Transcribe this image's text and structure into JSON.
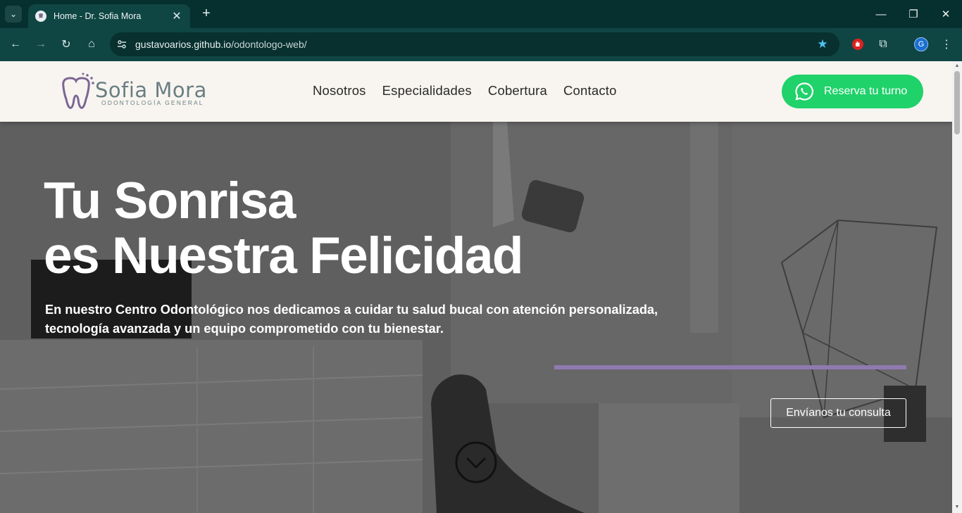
{
  "browser": {
    "tab_title": "Home - Dr. Sofia Mora",
    "new_tab": "+",
    "url_host": "gustavoarios.github.io",
    "url_path": "/odontologo-web/",
    "profile_initial": "G",
    "icons": [
      "tab-search-icon",
      "favicon-icon",
      "close-icon",
      "minimize-icon",
      "maximize-icon",
      "window-close-icon",
      "back-icon",
      "forward-icon",
      "reload-icon",
      "home-icon",
      "site-info-icon",
      "bookmark-star-icon",
      "extension-icon",
      "puzzle-icon",
      "more-icon"
    ]
  },
  "header": {
    "logo_name": "Sofia Mora",
    "logo_sub": "ODONTOLOGÍA GENERAL",
    "nav": [
      "Nosotros",
      "Especialidades",
      "Cobertura",
      "Contacto"
    ],
    "cta_label": "Reserva tu turno",
    "cta_color": "#1fd26a"
  },
  "hero": {
    "title_line1": "Tu Sonrisa",
    "title_line2": "es Nuestra Felicidad",
    "text_line1": "En nuestro Centro Odontológico nos dedicamos a cuidar tu salud bucal con atención personalizada,",
    "text_line2": "tecnología avanzada y un equipo comprometido con tu bienestar.",
    "consult_label": "Envíanos tu consulta",
    "accent_color": "#8f7ab0"
  }
}
